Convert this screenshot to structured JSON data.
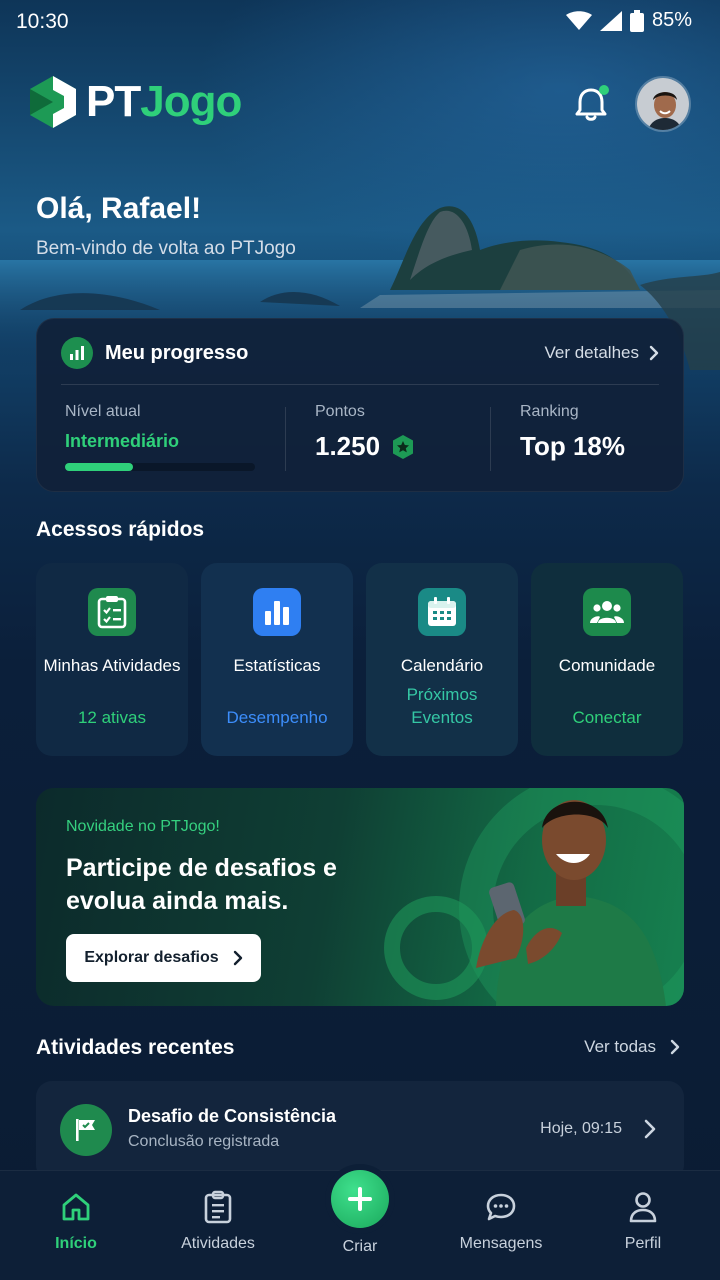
{
  "status_bar": {
    "time": "10:30",
    "battery": "85%"
  },
  "brand": {
    "pt": "PT",
    "jogo": "Jogo"
  },
  "greeting": {
    "title": "Olá, Rafael!",
    "subtitle": "Bem-vindo de volta ao PTJogo"
  },
  "progress": {
    "title": "Meu progresso",
    "link": "Ver detalhes",
    "level_label": "Nível atual",
    "level_value": "Intermediário",
    "level_progress_fraction": 0.36,
    "points_label": "Pontos",
    "points_value": "1.250",
    "ranking_label": "Ranking",
    "ranking_value": "Top 18%"
  },
  "quick_access": {
    "title": "Acessos rápidos",
    "tiles": [
      {
        "label": "Minhas Atividades",
        "sub": "12 ativas",
        "icon": "checklist-icon"
      },
      {
        "label": "Estatísticas",
        "sub": "Desempenho",
        "icon": "bar-chart-icon"
      },
      {
        "label": "Calendário",
        "sub": "Próximos Eventos",
        "icon": "calendar-icon"
      },
      {
        "label": "Comunidade",
        "sub": "Conectar",
        "icon": "people-icon"
      }
    ]
  },
  "promo": {
    "kicker": "Novidade no PTJogo!",
    "title": "Participe de desafios e evolua ainda mais.",
    "button": "Explorar desafios"
  },
  "recent": {
    "title": "Atividades recentes",
    "link": "Ver todas",
    "items": [
      {
        "title": "Desafio de Consistência",
        "subtitle": "Conclusão registrada",
        "time": "Hoje, 09:15",
        "icon": "flag-icon"
      }
    ]
  },
  "nav": {
    "items": [
      {
        "label": "Início",
        "icon": "home-icon",
        "active": true
      },
      {
        "label": "Atividades",
        "icon": "clipboard-icon"
      },
      {
        "label": "Criar",
        "icon": "plus-icon"
      },
      {
        "label": "Mensagens",
        "icon": "chat-icon"
      },
      {
        "label": "Perfil",
        "icon": "person-icon"
      }
    ]
  },
  "colors": {
    "accent": "#2fd07a",
    "blue_accent": "#2f7ff2",
    "background": "#0b1c33",
    "card": "#102138"
  }
}
